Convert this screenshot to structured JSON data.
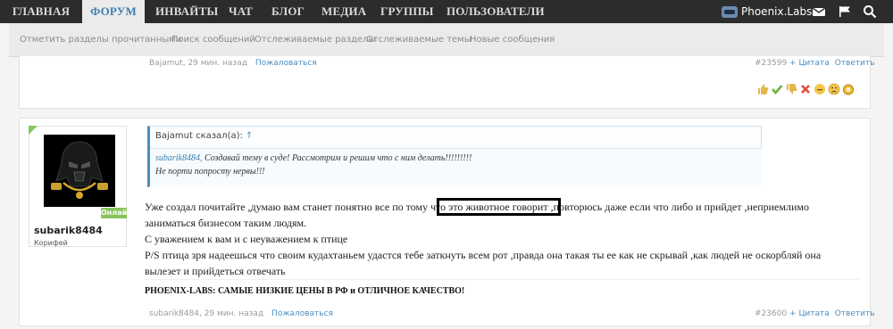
{
  "nav": {
    "items": [
      "ГЛАВНАЯ",
      "ФОРУМ",
      "ИНВАЙТЫ",
      "ЧАТ",
      "БЛОГ",
      "МЕДИА",
      "ГРУППЫ",
      "ПОЛЬЗОВАТЕЛИ"
    ],
    "active_index": 1,
    "brand": "Phoenix.Labs",
    "icons": [
      "mail-icon",
      "flag-icon",
      "search-icon"
    ]
  },
  "subnav": {
    "items": [
      "Отметить разделы прочитанными",
      "Поиск сообщений",
      "Отслеживаемые разделы",
      "Отслеживаемые темы",
      "Новые сообщения"
    ]
  },
  "post1": {
    "author": "Bajamut",
    "time": "29 мин. назад",
    "report": "Пожаловаться",
    "number": "#23599",
    "quote_link": "+ Цитата",
    "reply_link": "Ответить",
    "reactions": [
      "like",
      "agree",
      "dislike",
      "disagree",
      "neutral",
      "sad",
      "awesome"
    ]
  },
  "post2": {
    "username": "subarik8484",
    "user_title": "Корифей",
    "online_badge": "Онлайн",
    "quote": {
      "header": "Bajamut сказал(а):",
      "arrow": "↑",
      "name": "subarik8484,",
      "line1": " Создавай тему в суде! Рассмотрим и решим что с ним делать!!!!!!!!!",
      "line2": "Не порти попросту нервы!!!"
    },
    "body": [
      "Уже создал почитайте ,думаю вам станет понятно все по тому что это животное говорит ,повторюсь даже если что либо и прийдет ,неприемлимо",
      "заниматься бизнесом таким людям.",
      "С уважением к вам и с неуважением к птице",
      "P/S птица зря надеешься что своим кудахтаньем удастся тебе заткнуть всем рот ,правда она такая ты ее как не скрывай ,как людей не оскорбляй она",
      "вылезет и прийдеться отвечать"
    ],
    "signature": "PHOENIX-LABS: САМЫЕ НИЗКИЕ ЦЕНЫ В РФ и ОТЛИЧНОЕ КАЧЕСТВО!",
    "meta_author": "subarik8484",
    "time": "29 мин. назад",
    "report": "Пожаловаться",
    "number": "#23600",
    "quote_link": "+ Цитата",
    "reply_link": "Ответить"
  }
}
